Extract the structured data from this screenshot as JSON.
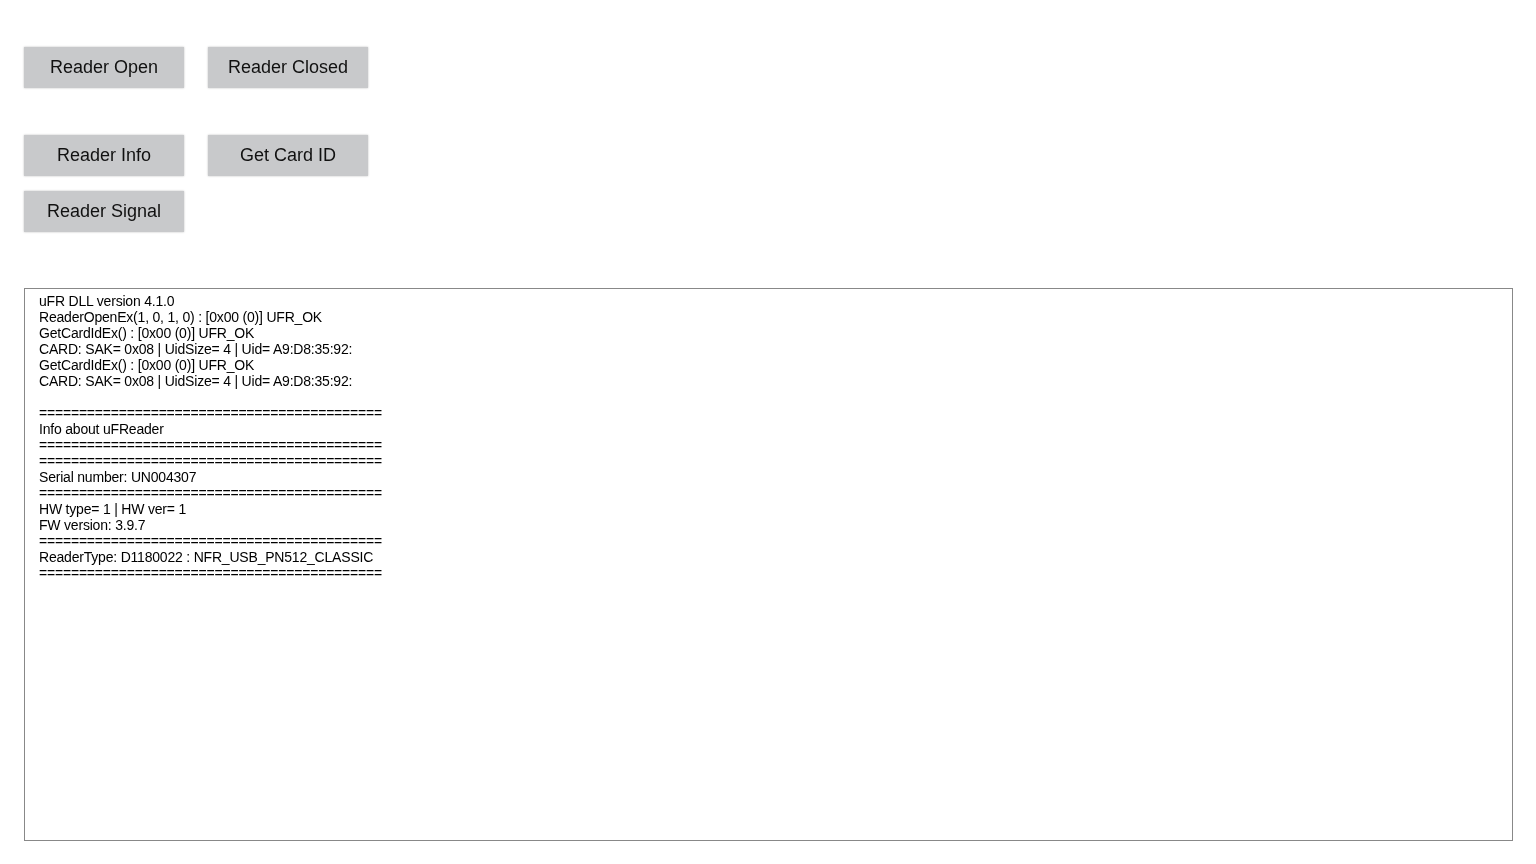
{
  "button_rows": [
    {
      "buttons": [
        "Reader Open",
        "Reader Closed"
      ]
    },
    {
      "buttons": [
        "Reader Info",
        "Get Card ID"
      ]
    },
    {
      "buttons": [
        "Reader Signal"
      ]
    }
  ],
  "log": {
    "lines": [
      {
        "kind": "text",
        "text": "uFR DLL version 4.1.0"
      },
      {
        "kind": "text",
        "text": "ReaderOpenEx(1, 0, 1, 0) : [0x00 (0)] UFR_OK"
      },
      {
        "kind": "text",
        "text": "GetCardIdEx() : [0x00 (0)] UFR_OK"
      },
      {
        "kind": "text",
        "text": "CARD: SAK= 0x08 | UidSize= 4 | Uid= A9:D8:35:92:"
      },
      {
        "kind": "text",
        "text": "GetCardIdEx() : [0x00 (0)] UFR_OK"
      },
      {
        "kind": "text",
        "text": "CARD: SAK= 0x08 | UidSize= 4 | Uid= A9:D8:35:92:"
      },
      {
        "kind": "blank"
      },
      {
        "kind": "text",
        "text": "==========================================="
      },
      {
        "kind": "text",
        "text": "Info about uFReader"
      },
      {
        "kind": "text",
        "text": "==========================================="
      },
      {
        "kind": "text",
        "text": "==========================================="
      },
      {
        "kind": "text",
        "text": "Serial number: UN004307"
      },
      {
        "kind": "text",
        "text": "==========================================="
      },
      {
        "kind": "text",
        "text": "HW type= 1 | HW ver= 1"
      },
      {
        "kind": "text",
        "text": "FW version: 3.9.7"
      },
      {
        "kind": "text",
        "text": "==========================================="
      },
      {
        "kind": "text",
        "text": "ReaderType: D1180022 : NFR_USB_PN512_CLASSIC"
      },
      {
        "kind": "text",
        "text": "==========================================="
      }
    ]
  }
}
